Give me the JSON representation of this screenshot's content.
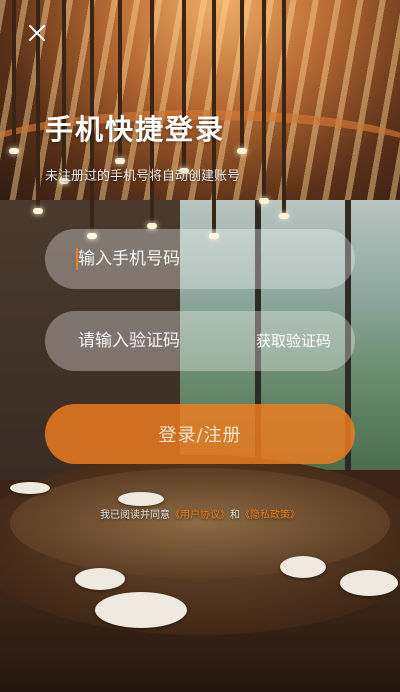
{
  "header": {
    "title": "手机快捷登录",
    "subtitle": "未注册过的手机号将自动创建账号"
  },
  "form": {
    "phone_placeholder": "输入手机号码",
    "code_placeholder": "请输入验证码",
    "get_code_label": "获取验证码",
    "submit_label": "登录/注册"
  },
  "agreement": {
    "prefix": "我已阅读并同意",
    "link1": "《用户协议》",
    "middle": "和",
    "link2": "《隐私政策》"
  },
  "colors": {
    "accent": "#f07f1f",
    "text": "#ffffff"
  },
  "icons": {
    "close": "close-icon"
  }
}
